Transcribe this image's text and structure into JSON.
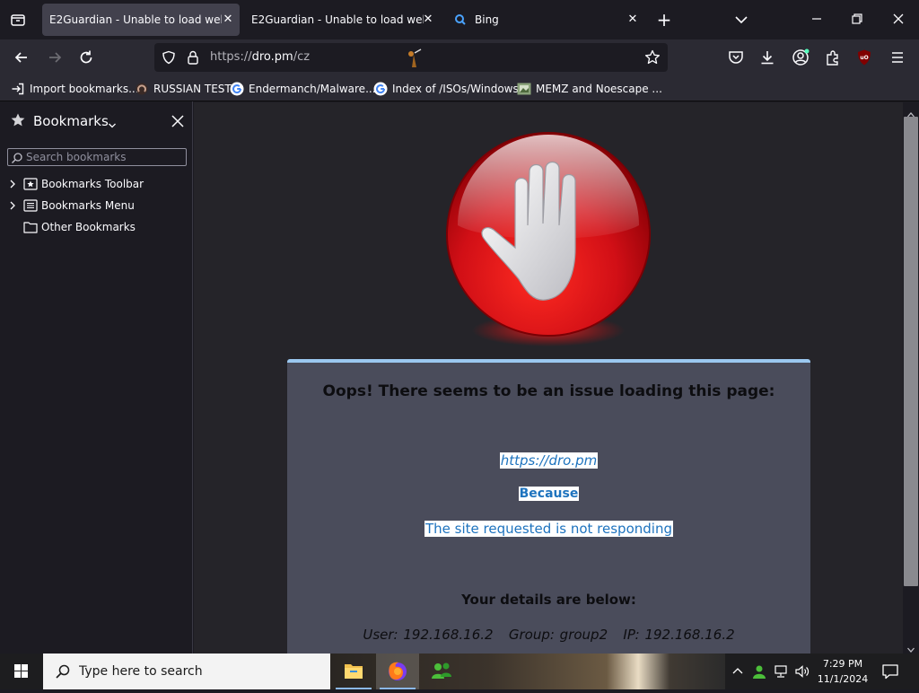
{
  "tabs": [
    {
      "title": "E2Guardian - Unable to load website",
      "selected": true
    },
    {
      "title": "E2Guardian - Unable to load website",
      "selected": false
    },
    {
      "title": "Bing",
      "selected": false
    }
  ],
  "url": {
    "prefix": "https://",
    "host": "dro.pm",
    "path": "/cz"
  },
  "bookmarks_toolbar": [
    {
      "label": "Import bookmarks...",
      "icon": "import-icon"
    },
    {
      "label": "RUSSIAN TEST",
      "icon": "site-favicon"
    },
    {
      "label": "Endermanch/Malware...",
      "icon": "google-icon"
    },
    {
      "label": "Index of /ISOs/Windows",
      "icon": "google-icon"
    },
    {
      "label": "MEMZ and Noescape ...",
      "icon": "image-favicon"
    }
  ],
  "sidebar": {
    "title": "Bookmarks",
    "search_placeholder": "Search bookmarks",
    "tree": [
      {
        "label": "Bookmarks Toolbar",
        "expandable": true,
        "icon": "star-folder-icon"
      },
      {
        "label": "Bookmarks Menu",
        "expandable": true,
        "icon": "menu-folder-icon"
      },
      {
        "label": "Other Bookmarks",
        "expandable": false,
        "icon": "folder-icon"
      }
    ]
  },
  "page": {
    "heading": "Oops! There seems to be an issue loading this page:",
    "blocked_url": "https://dro.pm",
    "because": "Because",
    "reason": "The site requested is not responding",
    "details_heading": "Your details are below:",
    "details": "User: 192.168.16.2   Group: group2   IP: 192.168.16.2"
  },
  "taskbar": {
    "search_placeholder": "Type here to search",
    "time": "7:29 PM",
    "date": "11/1/2024",
    "apps": [
      "file-explorer",
      "firefox",
      "messenger"
    ]
  },
  "colors": {
    "accent_blue": "#1e73be",
    "stop_red": "#e0141b",
    "card_bg": "#4a4c5b"
  }
}
